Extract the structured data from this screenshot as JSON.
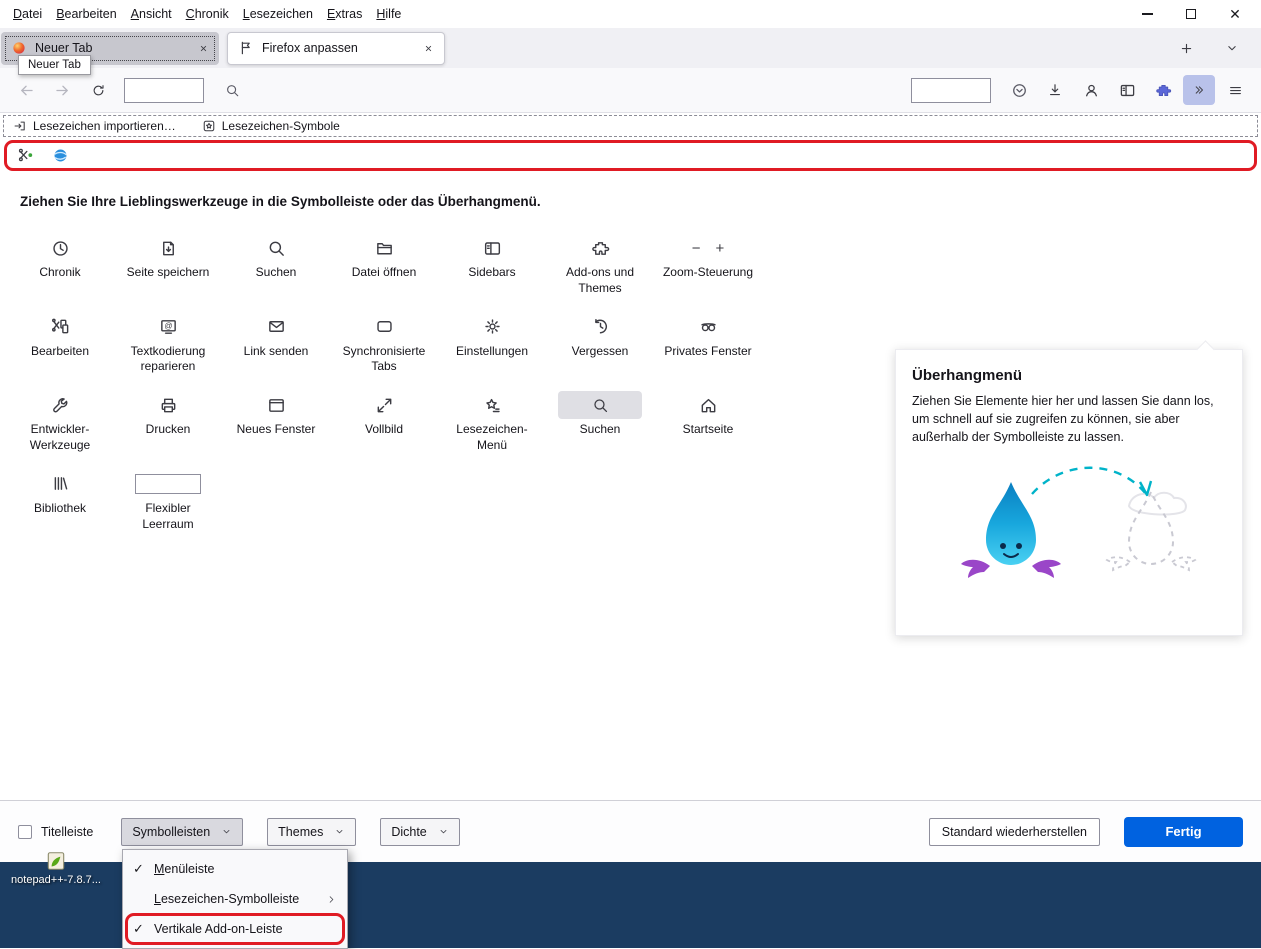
{
  "colors": {
    "highlight_red": "#e01b24",
    "done_blue": "#0062e0",
    "desktop_bg": "#1b3c61",
    "overflow_button_bg": "#b9c2ea"
  },
  "menu_bar": {
    "items": [
      "Datei",
      "Bearbeiten",
      "Ansicht",
      "Chronik",
      "Lesezeichen",
      "Extras",
      "Hilfe"
    ]
  },
  "tab_bar": {
    "tabs": [
      {
        "title": "Neuer Tab",
        "active": false,
        "icon": "firefox-favicon"
      },
      {
        "title": "Firefox anpassen",
        "active": true,
        "icon": "customize-flag"
      }
    ]
  },
  "tooltip": {
    "text": "Neuer Tab"
  },
  "bookmarks_bar": {
    "items": [
      {
        "label": "Lesezeichen importieren…",
        "icon": "import"
      },
      {
        "label": "Lesezeichen-Symbole",
        "icon": "bookmark-box"
      }
    ]
  },
  "addon_bar": {
    "icons": [
      "addon-scissors",
      "addon-globe"
    ]
  },
  "customize": {
    "instruction": "Ziehen Sie Ihre Lieblingswerkzeuge in die Symbolleiste oder das Überhangmenü.",
    "palette": [
      {
        "label": "Chronik",
        "icon": "clock"
      },
      {
        "label": "Seite speichern",
        "icon": "save-page"
      },
      {
        "label": "Suchen",
        "icon": "search"
      },
      {
        "label": "Datei öffnen",
        "icon": "open-file"
      },
      {
        "label": "Sidebars",
        "icon": "sidebar"
      },
      {
        "label": "Add-ons und Themes",
        "icon": "addons"
      },
      {
        "label": "Zoom-Steuerung",
        "icon": "zoom"
      },
      {
        "label": "Bearbeiten",
        "icon": "edit"
      },
      {
        "label": "Textkodierung reparieren",
        "icon": "text-encoding"
      },
      {
        "label": "Link senden",
        "icon": "email-link"
      },
      {
        "label": "Synchronisierte Tabs",
        "icon": "synced-tabs"
      },
      {
        "label": "Einstellungen",
        "icon": "settings"
      },
      {
        "label": "Vergessen",
        "icon": "forget"
      },
      {
        "label": "Privates Fenster",
        "icon": "private"
      },
      {
        "label": "Entwickler-Werkzeuge",
        "icon": "devtools"
      },
      {
        "label": "Drucken",
        "icon": "print"
      },
      {
        "label": "Neues Fenster",
        "icon": "new-window"
      },
      {
        "label": "Vollbild",
        "icon": "fullscreen"
      },
      {
        "label": "Lesezeichen-Menü",
        "icon": "bookmarks-menu"
      },
      {
        "label": "Suchen",
        "icon": "search",
        "boxed": true
      },
      {
        "label": "Startseite",
        "icon": "home"
      },
      {
        "label": "Bibliothek",
        "icon": "library"
      },
      {
        "label": "Flexibler Leerraum",
        "icon": "flexible-space"
      }
    ],
    "overflow_panel": {
      "title": "Überhangmenü",
      "description": "Ziehen Sie Elemente hier her und lassen Sie dann los, um schnell auf sie zugreifen zu können, sie aber außerhalb der Symbolleiste zu lassen."
    },
    "footer": {
      "titlebar_label": "Titelleiste",
      "titlebar_checked": false,
      "dropdowns": [
        {
          "label": "Symbolleisten",
          "open": true
        },
        {
          "label": "Themes",
          "open": false
        },
        {
          "label": "Dichte",
          "open": false
        }
      ],
      "restore_label": "Standard wiederherstellen",
      "done_label": "Fertig"
    }
  },
  "toolbars_menu": {
    "items": [
      {
        "label": "Menüleiste",
        "checked": true,
        "accel": true,
        "submenu": false,
        "highlighted": false
      },
      {
        "label": "Lesezeichen-Symbolleiste",
        "checked": false,
        "accel": true,
        "submenu": true,
        "highlighted": false
      },
      {
        "label": "Vertikale Add-on-Leiste",
        "checked": true,
        "accel": false,
        "submenu": false,
        "highlighted": true
      }
    ]
  },
  "desktop": {
    "icon_label": "notepad++-7.8.7..."
  }
}
